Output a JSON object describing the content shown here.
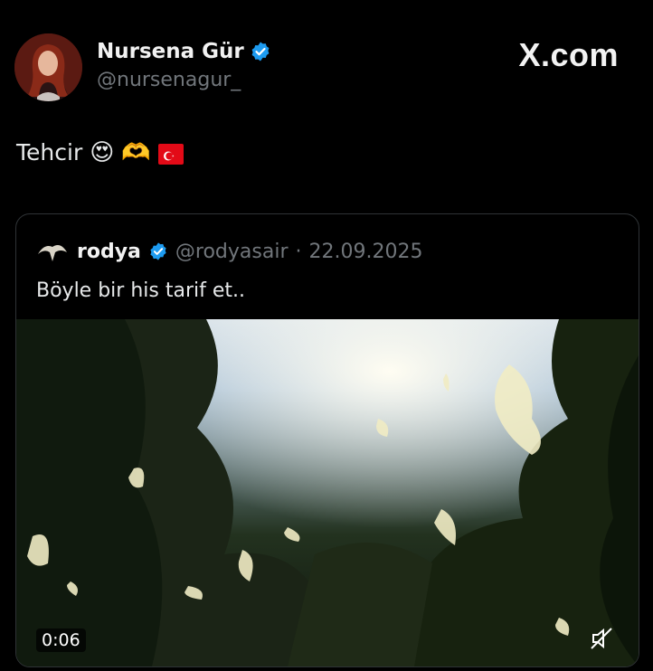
{
  "brand": "X.com",
  "tweet": {
    "author_name": "Nursena Gür",
    "author_handle": "@nursenagur_",
    "text": "Tehcir",
    "emojis": [
      "heart-eyes-emoji",
      "heart-hands-emoji",
      "turkey-flag-emoji"
    ]
  },
  "quote": {
    "author_name": "rodya",
    "author_handle": "@rodyasair",
    "separator": "·",
    "date": "22.09.2025",
    "text": "Böyle bir his tarif et..",
    "video": {
      "duration": "0:06",
      "muted": true
    }
  },
  "colors": {
    "background": "#000000",
    "text": "#e7e9ea",
    "muted_text": "#71767b",
    "verified_blue": "#1d9bf0",
    "border": "#2f3336"
  }
}
